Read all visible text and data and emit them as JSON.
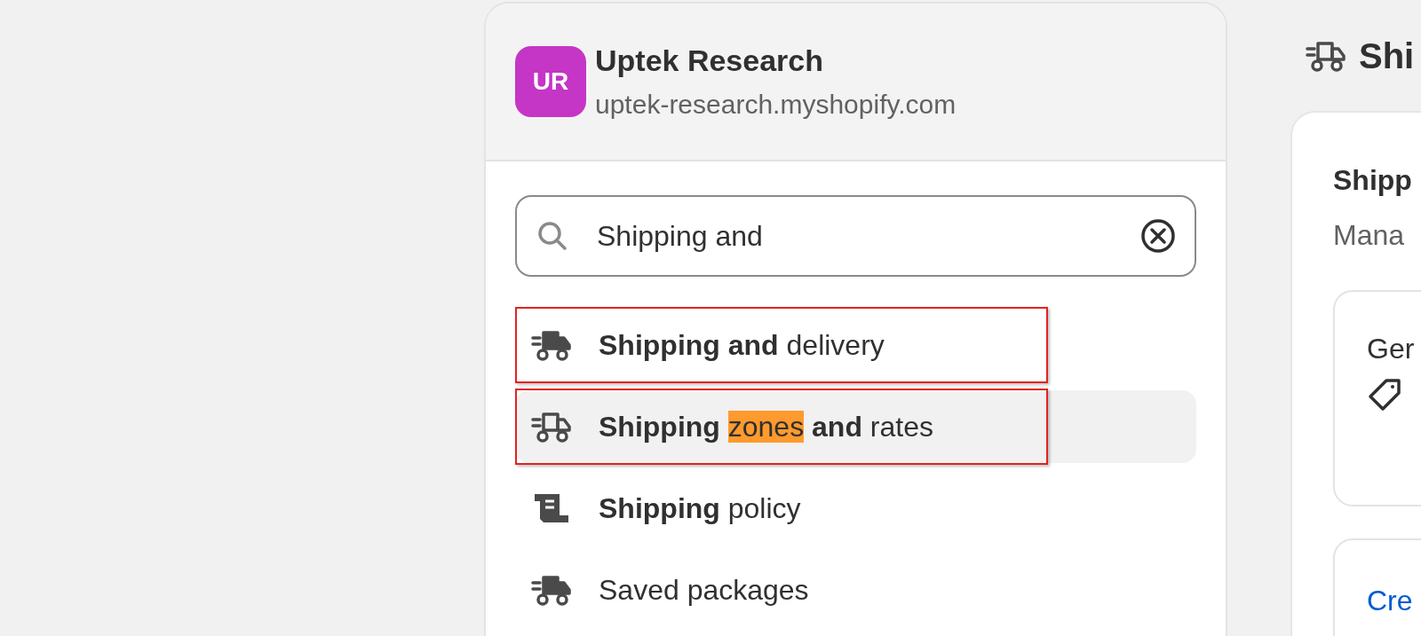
{
  "store": {
    "initials": "UR",
    "color": "#c535c6",
    "name": "Uptek Research",
    "domain": "uptek-research.myshopify.com"
  },
  "search": {
    "value": "Shipping and"
  },
  "results": [
    {
      "selected": false,
      "outlined": true,
      "segments": [
        {
          "text": "Shipping and",
          "bold": true,
          "highlight": false
        },
        {
          "text": " delivery",
          "bold": false,
          "highlight": false
        }
      ]
    },
    {
      "selected": true,
      "outlined": true,
      "segments": [
        {
          "text": "Shipping ",
          "bold": true,
          "highlight": false
        },
        {
          "text": "zones",
          "bold": false,
          "highlight": true
        },
        {
          "text": " and",
          "bold": true,
          "highlight": false
        },
        {
          "text": " rates",
          "bold": false,
          "highlight": false
        }
      ]
    },
    {
      "selected": false,
      "outlined": false,
      "segments": [
        {
          "text": "Shipping",
          "bold": true,
          "highlight": false
        },
        {
          "text": " policy",
          "bold": false,
          "highlight": false
        }
      ]
    },
    {
      "selected": false,
      "outlined": false,
      "segments": [
        {
          "text": "Saved packages",
          "bold": false,
          "highlight": false
        }
      ]
    }
  ],
  "page": {
    "title": "Shi",
    "section_title": "Shipp",
    "section_text": "Mana",
    "card_title": "Ger",
    "link": "Cre"
  }
}
